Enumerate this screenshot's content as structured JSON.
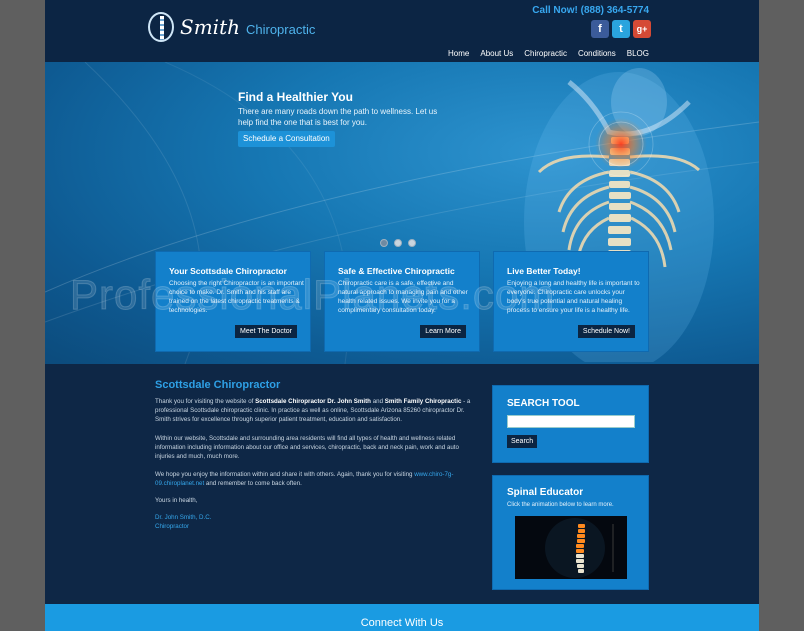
{
  "brand": {
    "name_script": "Smith",
    "name_rest": "Chiropractic"
  },
  "header": {
    "call": "Call Now! (888) 364-5774"
  },
  "social": [
    {
      "icon": "facebook-icon",
      "glyph": "f"
    },
    {
      "icon": "twitter-icon",
      "glyph": "t"
    },
    {
      "icon": "google-plus-icon",
      "glyph": "g+"
    }
  ],
  "nav": [
    "Home",
    "About Us",
    "Chiropractic",
    "Conditions",
    "BLOG"
  ],
  "hero": {
    "title": "Find a Healthier You",
    "text": "There are many roads down the path to wellness. Let us help find the one that is best for you.",
    "button": "Schedule a Consultation",
    "slide_count": 3,
    "active_slide": 1
  },
  "cards": [
    {
      "title": "Your Scottsdale Chiropractor",
      "text": "Choosing the right Chiropractor is an important choice to make. Dr. Smith and his staff are trained on the latest chiropractic treatments & technologies.",
      "button": "Meet The Doctor"
    },
    {
      "title": "Safe & Effective Chiropractic",
      "text": "Chiropractic care is a safe, effective and natural approach to managing pain and other health related issues. We invite you for a complimentary consultation today.",
      "button": "Learn More"
    },
    {
      "title": "Live Better Today!",
      "text": "Enjoying a long and healthy life is important to everyone. Chiropractic care unlocks your body's true potential and natural healing process to ensure your life is a healthy life.",
      "button": "Schedule Now!"
    }
  ],
  "watermark": "ProfessionalPlanets.com",
  "main": {
    "title": "Scottsdale Chiropractor",
    "p1_a": "Thank you for visiting the website of ",
    "p1_b": "Scottsdale Chiropractor Dr. John Smith",
    "p1_c": " and ",
    "p1_d": "Smith Family Chiropractic",
    "p1_e": " - a professional Scottsdale chiropractic clinic. In practice as well as online, Scottsdale Arizona 85260 chiropractor Dr. Smith strives for excellence through superior patient treatment, education and satisfaction.",
    "p2": "Within our website, Scottsdale and surrounding area residents will find all types of health and wellness related information including information about our office and services, chiropractic, back and neck pain, work and auto injuries and much, much more.",
    "p3_a": "We hope you enjoy the information within and share it with others. Again, thank you for visiting ",
    "p3_link": "www.chiro-7g-09.chiroplanet.net",
    "p3_b": " and remember to come back often.",
    "closing": "Yours in health,",
    "sig_name": "Dr. John Smith, D.C.",
    "sig_title": "Chiropractor"
  },
  "search": {
    "title": "SEARCH TOOL",
    "value": "",
    "button": "Search"
  },
  "educator": {
    "title": "Spinal Educator",
    "text": "Click the animation below to learn more."
  },
  "footer": {
    "title": "Connect With Us"
  }
}
